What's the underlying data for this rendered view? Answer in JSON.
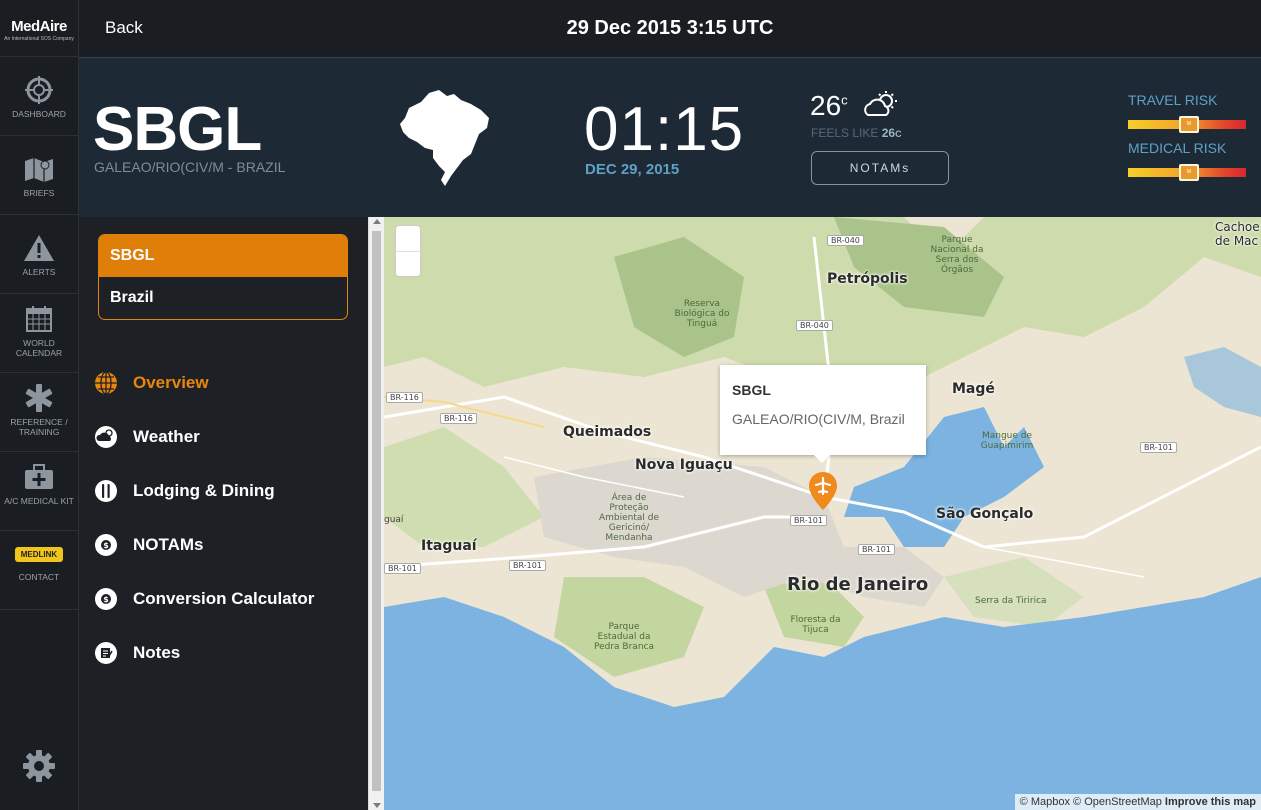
{
  "app": {
    "logo_text": "MedAire",
    "logo_tagline": "An International SOS Company"
  },
  "rail": {
    "items": [
      {
        "label": "DASHBOARD",
        "icon": "compass-icon"
      },
      {
        "label": "BRIEFS",
        "icon": "map-icon"
      },
      {
        "label": "ALERTS",
        "icon": "warning-icon"
      },
      {
        "label": "WORLD CALENDAR",
        "icon": "calendar-icon"
      },
      {
        "label": "REFERENCE / TRAINING",
        "icon": "medical-star-icon"
      },
      {
        "label": "A/C MEDICAL KIT",
        "icon": "medical-kit-icon"
      },
      {
        "label": "CONTACT",
        "badge": "MEDLINK"
      }
    ],
    "settings_icon": "gear-icon"
  },
  "topbar": {
    "back_label": "Back",
    "datetime": "29 Dec 2015 3:15 UTC"
  },
  "header": {
    "code": "SBGL",
    "airport_name": "GALEAO/RIO(CIV/M - BRAZIL",
    "local_time": "01:15",
    "local_date": "DEC 29, 2015",
    "temperature": "26",
    "temp_unit": "c",
    "feels_like_label": "FEELS LIKE",
    "feels_like_value": "26",
    "feels_like_unit": "C",
    "notams_label": "NOTAMs",
    "travel_risk_label": "TRAVEL RISK",
    "travel_risk_level": "M",
    "medical_risk_label": "MEDICAL RISK",
    "medical_risk_level": "M",
    "accent": "#5fa0c6"
  },
  "side": {
    "tab_code": "SBGL",
    "tab_country": "Brazil",
    "menu": [
      {
        "label": "Overview",
        "icon": "globe-icon",
        "active": true
      },
      {
        "label": "Weather",
        "icon": "weather-icon",
        "active": false
      },
      {
        "label": "Lodging & Dining",
        "icon": "utensils-icon",
        "active": false
      },
      {
        "label": "NOTAMs",
        "icon": "dollar-icon",
        "active": false
      },
      {
        "label": "Conversion Calculator",
        "icon": "dollar-icon",
        "active": false
      },
      {
        "label": "Notes",
        "icon": "notes-icon",
        "active": false
      }
    ],
    "accent": "#df7f0a"
  },
  "map": {
    "popup_title": "SBGL",
    "popup_subtitle": "GALEAO/RIO(CIV/M, Brazil",
    "labels": {
      "petropolis": "Petrópolis",
      "mage": "Magé",
      "queimados": "Queimados",
      "nova_iguacu": "Nova Iguaçu",
      "sao_goncalo": "São Gonçalo",
      "itaguai": "Itaguaí",
      "rio": "Rio de Janeiro",
      "cachoeiras": "Cachoe de Mac",
      "parque_serra": "Parque Nacional da Serra dos Órgãos",
      "reserva_tingua": "Reserva Biológica do Tinguá",
      "gericino": "Área de Proteção Ambiental de Gericinó/ Mendanha",
      "guapimirim": "Mangue de Guapimirim",
      "tijuca": "Floresta da Tijuca",
      "pedra_branca": "Parque Estadual da Pedra Branca",
      "tiririca": "Serra da Tiririca",
      "iguai": "guaí"
    },
    "roads": [
      "BR-040",
      "BR-040",
      "BR-116",
      "BR-116",
      "BR-101",
      "BR-101",
      "BR-101",
      "BR-101",
      "BR-101"
    ],
    "attribution_mapbox": "© Mapbox",
    "attribution_osm": "© OpenStreetMap",
    "attribution_improve": "Improve this map"
  }
}
